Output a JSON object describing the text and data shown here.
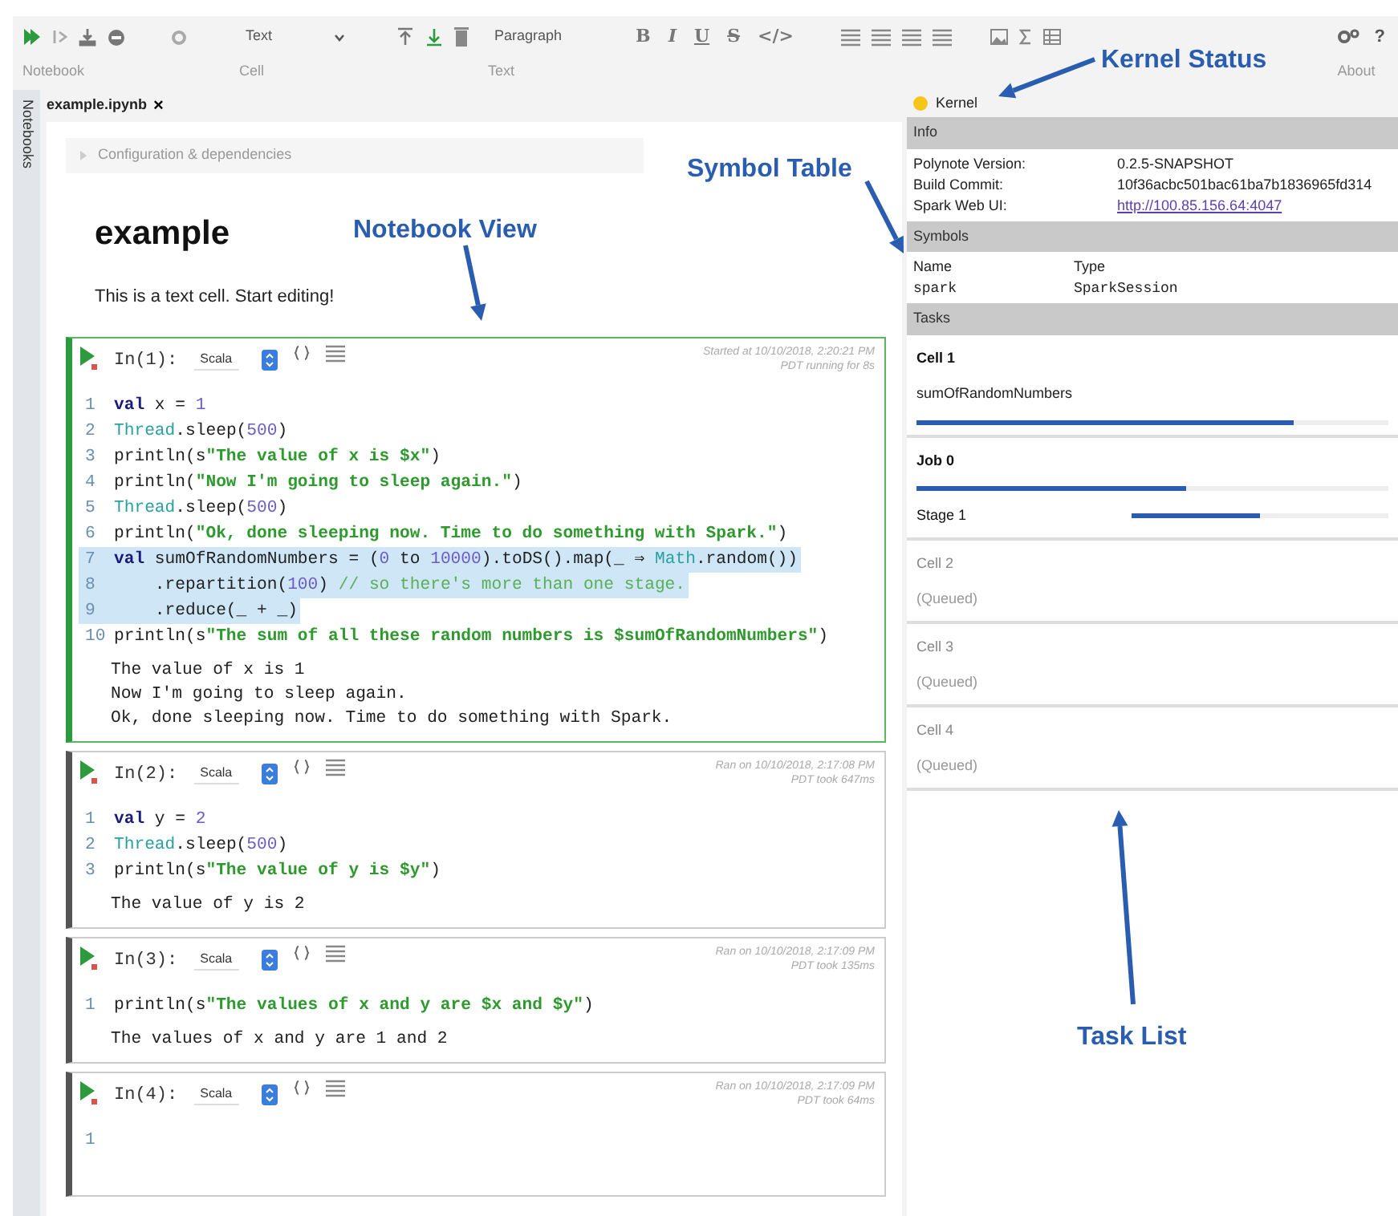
{
  "toolbar": {
    "group_labels": [
      "Notebook",
      "Cell",
      "Text",
      "About"
    ],
    "cell_type": "Text",
    "paragraph_style": "Paragraph",
    "format_buttons": [
      "B",
      "I",
      "U",
      "S",
      "</>"
    ],
    "help": "?"
  },
  "sidebar_tab": "Notebooks",
  "notebook": {
    "tab": {
      "title": "example.ipynb",
      "close": "×"
    },
    "config": "Configuration & dependencies",
    "heading": "example",
    "paragraph": "This is a text cell. Start editing!",
    "cells": [
      {
        "prompt": "In(1):",
        "language": "Scala",
        "timestamp": "Started at 10/10/2018, 2:20:21 PM PDT running for 8s",
        "active": true,
        "code": [
          {
            "number": "1",
            "tokens": [
              {
                "kind": "kw",
                "text": "val"
              },
              {
                "kind": "p",
                "text": " x = "
              },
              {
                "kind": "num",
                "text": "1"
              }
            ],
            "highlighted": false
          },
          {
            "number": "2",
            "tokens": [
              {
                "kind": "type",
                "text": "Thread"
              },
              {
                "kind": "p",
                "text": ".sleep("
              },
              {
                "kind": "num",
                "text": "500"
              },
              {
                "kind": "p",
                "text": ")"
              }
            ],
            "highlighted": false
          },
          {
            "number": "3",
            "tokens": [
              {
                "kind": "p",
                "text": "println(s"
              },
              {
                "kind": "str",
                "text": "\"The value of x is $x\""
              },
              {
                "kind": "p",
                "text": ")"
              }
            ],
            "highlighted": false
          },
          {
            "number": "4",
            "tokens": [
              {
                "kind": "p",
                "text": "println("
              },
              {
                "kind": "str",
                "text": "\"Now I'm going to sleep again.\""
              },
              {
                "kind": "p",
                "text": ")"
              }
            ],
            "highlighted": false
          },
          {
            "number": "5",
            "tokens": [
              {
                "kind": "type",
                "text": "Thread"
              },
              {
                "kind": "p",
                "text": ".sleep("
              },
              {
                "kind": "num",
                "text": "500"
              },
              {
                "kind": "p",
                "text": ")"
              }
            ],
            "highlighted": false
          },
          {
            "number": "6",
            "tokens": [
              {
                "kind": "p",
                "text": "println("
              },
              {
                "kind": "str",
                "text": "\"Ok, done sleeping now. Time to do something with Spark.\""
              },
              {
                "kind": "p",
                "text": ")"
              }
            ],
            "highlighted": false
          },
          {
            "number": "7",
            "tokens": [
              {
                "kind": "kw",
                "text": "val"
              },
              {
                "kind": "p",
                "text": " sumOfRandomNumbers = ("
              },
              {
                "kind": "num",
                "text": "0"
              },
              {
                "kind": "p",
                "text": " to "
              },
              {
                "kind": "num",
                "text": "10000"
              },
              {
                "kind": "p",
                "text": ").toDS().map(_ ⇒ "
              },
              {
                "kind": "type",
                "text": "Math"
              },
              {
                "kind": "p",
                "text": ".random())"
              }
            ],
            "highlighted": true
          },
          {
            "number": "8",
            "tokens": [
              {
                "kind": "p",
                "text": "    .repartition("
              },
              {
                "kind": "num",
                "text": "100"
              },
              {
                "kind": "p",
                "text": ") "
              },
              {
                "kind": "cmt",
                "text": "// so there's more than one stage."
              }
            ],
            "highlighted": true
          },
          {
            "number": "9",
            "tokens": [
              {
                "kind": "p",
                "text": "    .reduce(_ + _)"
              }
            ],
            "highlighted": true
          },
          {
            "number": "10",
            "tokens": [
              {
                "kind": "p",
                "text": "println(s"
              },
              {
                "kind": "str",
                "text": "\"The sum of all these random numbers is $sumOfRandomNumbers\""
              },
              {
                "kind": "p",
                "text": ")"
              }
            ],
            "highlighted": false
          }
        ],
        "output": [
          "The value of x is 1",
          "Now I'm going to sleep again.",
          "Ok, done sleeping now. Time to do something with Spark."
        ]
      },
      {
        "prompt": "In(2):",
        "language": "Scala",
        "timestamp": "Ran on 10/10/2018, 2:17:08 PM PDT took 647ms",
        "active": false,
        "code": [
          {
            "number": "1",
            "tokens": [
              {
                "kind": "kw",
                "text": "val"
              },
              {
                "kind": "p",
                "text": " y = "
              },
              {
                "kind": "num",
                "text": "2"
              }
            ],
            "highlighted": false
          },
          {
            "number": "2",
            "tokens": [
              {
                "kind": "type",
                "text": "Thread"
              },
              {
                "kind": "p",
                "text": ".sleep("
              },
              {
                "kind": "num",
                "text": "500"
              },
              {
                "kind": "p",
                "text": ")"
              }
            ],
            "highlighted": false
          },
          {
            "number": "3",
            "tokens": [
              {
                "kind": "p",
                "text": "println(s"
              },
              {
                "kind": "str",
                "text": "\"The value of y is $y\""
              },
              {
                "kind": "p",
                "text": ")"
              }
            ],
            "highlighted": false
          }
        ],
        "output": [
          "The value of y is 2"
        ]
      },
      {
        "prompt": "In(3):",
        "language": "Scala",
        "timestamp": "Ran on 10/10/2018, 2:17:09 PM PDT took 135ms",
        "active": false,
        "code": [
          {
            "number": "1",
            "tokens": [
              {
                "kind": "p",
                "text": "println(s"
              },
              {
                "kind": "str",
                "text": "\"The values of x and y are $x and $y\""
              },
              {
                "kind": "p",
                "text": ")"
              }
            ],
            "highlighted": false
          }
        ],
        "output": [
          "The values of x and y are 1 and 2"
        ]
      },
      {
        "prompt": "In(4):",
        "language": "Scala",
        "timestamp": "Ran on 10/10/2018, 2:17:09 PM PDT took 64ms",
        "active": false,
        "code": [
          {
            "number": "1",
            "highlighted": false
          }
        ]
      }
    ]
  },
  "kernel": {
    "label": "Kernel",
    "busy": true
  },
  "info": {
    "title": "Info",
    "rows": [
      {
        "label": "Polynote Version:",
        "value": "0.2.5-SNAPSHOT",
        "kind": "text"
      },
      {
        "label": "Build Commit:",
        "value": "10f36acbc501bac61ba7b1836965fd314",
        "kind": "text"
      },
      {
        "label": "Spark Web UI:",
        "value": "http://100.85.156.64:4047",
        "kind": "link"
      }
    ]
  },
  "symbols": {
    "title": "Symbols",
    "columns": [
      "Name",
      "Type"
    ],
    "rows": [
      [
        "spark",
        "SparkSession"
      ]
    ]
  },
  "tasks": {
    "title": "Tasks",
    "items": [
      {
        "title": "Cell 1",
        "detail": "sumOfRandomNumbers",
        "level": 0.8,
        "queued": false
      },
      {
        "title": "Job 0",
        "level": 0.57,
        "queued": false,
        "children": [
          {
            "title": "Stage 1",
            "level": 0.5
          }
        ]
      },
      {
        "title": "Cell 2",
        "detail": "(Queued)",
        "queued": true
      },
      {
        "title": "Cell 3",
        "detail": "(Queued)",
        "queued": true
      },
      {
        "title": "Cell 4",
        "detail": "(Queued)",
        "queued": true
      }
    ]
  },
  "annotations": [
    {
      "text": "Kernel Status",
      "kind": "kernel"
    },
    {
      "text": "Symbol Table",
      "kind": "symbols"
    },
    {
      "text": "Notebook View",
      "kind": "notebook"
    },
    {
      "text": "Task List",
      "kind": "tasks"
    }
  ]
}
